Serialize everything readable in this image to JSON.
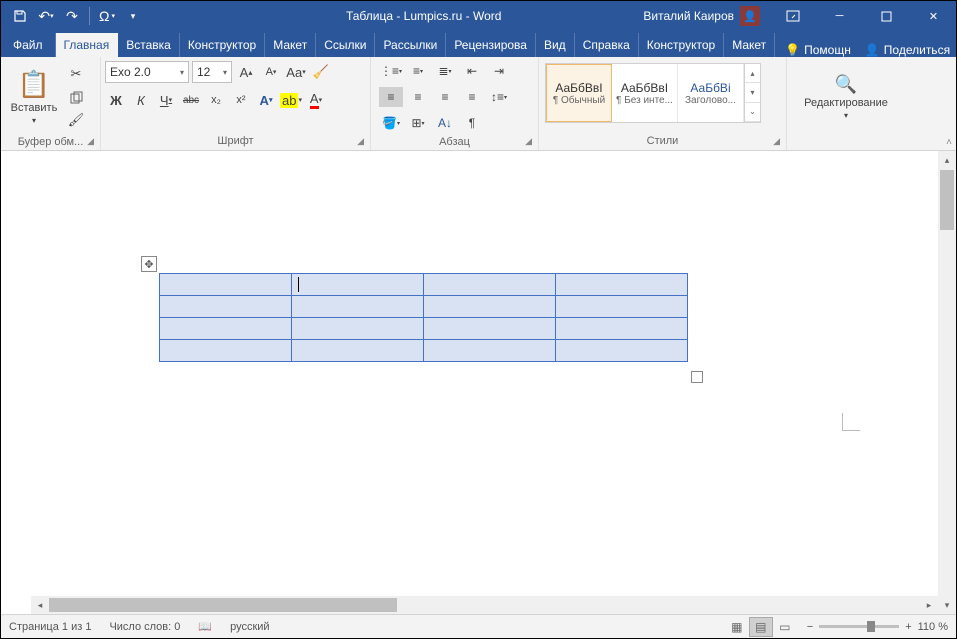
{
  "title": "Таблица - Lumpics.ru  -  Word",
  "user": "Виталий Каиров",
  "tabs": {
    "file": "Файл",
    "items": [
      "Главная",
      "Вставка",
      "Конструктор",
      "Макет",
      "Ссылки",
      "Рассылки",
      "Рецензирова",
      "Вид",
      "Справка",
      "Конструктор",
      "Макет"
    ],
    "tell": "Помощн",
    "share": "Поделиться"
  },
  "ribbon": {
    "clipboard": {
      "label": "Буфер обм...",
      "paste": "Вставить"
    },
    "font": {
      "label": "Шрифт",
      "name": "Exo 2.0",
      "size": "12",
      "btns": {
        "b": "Ж",
        "i": "К",
        "u": "Ч",
        "s": "abc",
        "sub": "x₂",
        "sup": "x²"
      }
    },
    "para": {
      "label": "Абзац"
    },
    "styles": {
      "label": "Стили",
      "items": [
        {
          "prev": "АаБбВвI",
          "name": "¶ Обычный"
        },
        {
          "prev": "АаБбВвI",
          "name": "¶ Без инте..."
        },
        {
          "prev": "АаБбВі",
          "name": "Заголово..."
        }
      ]
    },
    "editing": {
      "label": "Редактирование"
    }
  },
  "table": {
    "rows": 4,
    "cols": 4
  },
  "status": {
    "page": "Страница 1 из 1",
    "words": "Число слов: 0",
    "lang": "русский",
    "zoom": "110 %"
  }
}
